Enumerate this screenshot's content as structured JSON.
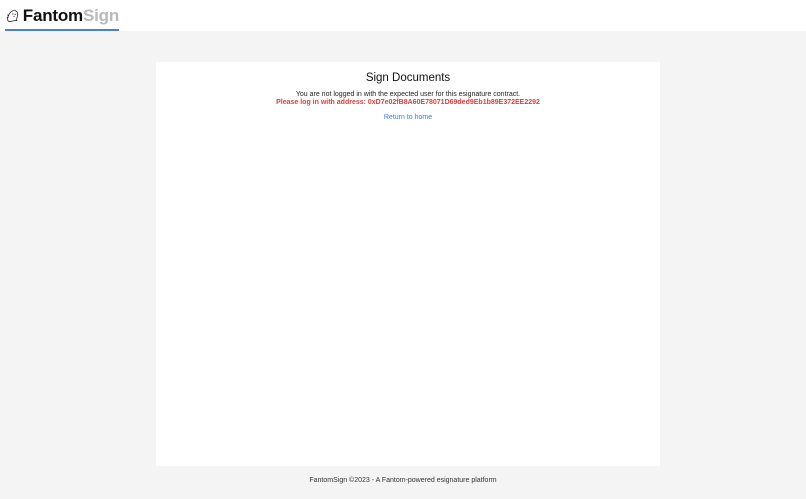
{
  "header": {
    "brand_primary": "Fantom",
    "brand_secondary": "Sign",
    "logo_icon": "ghost-icon",
    "accent_color": "#4a7fd6"
  },
  "main": {
    "title": "Sign Documents",
    "message": "You are not logged in with the expected user for this esignature contract.",
    "warning": "Please log in with address: 0xD7e02fB8A60E78071D69ded9Eb1b89E372EE2292",
    "warning_color": "#e03b3b",
    "return_link": "Return to home"
  },
  "footer": {
    "text": "FantomSign ©2023 - A Fantom-powered esignature platform"
  }
}
